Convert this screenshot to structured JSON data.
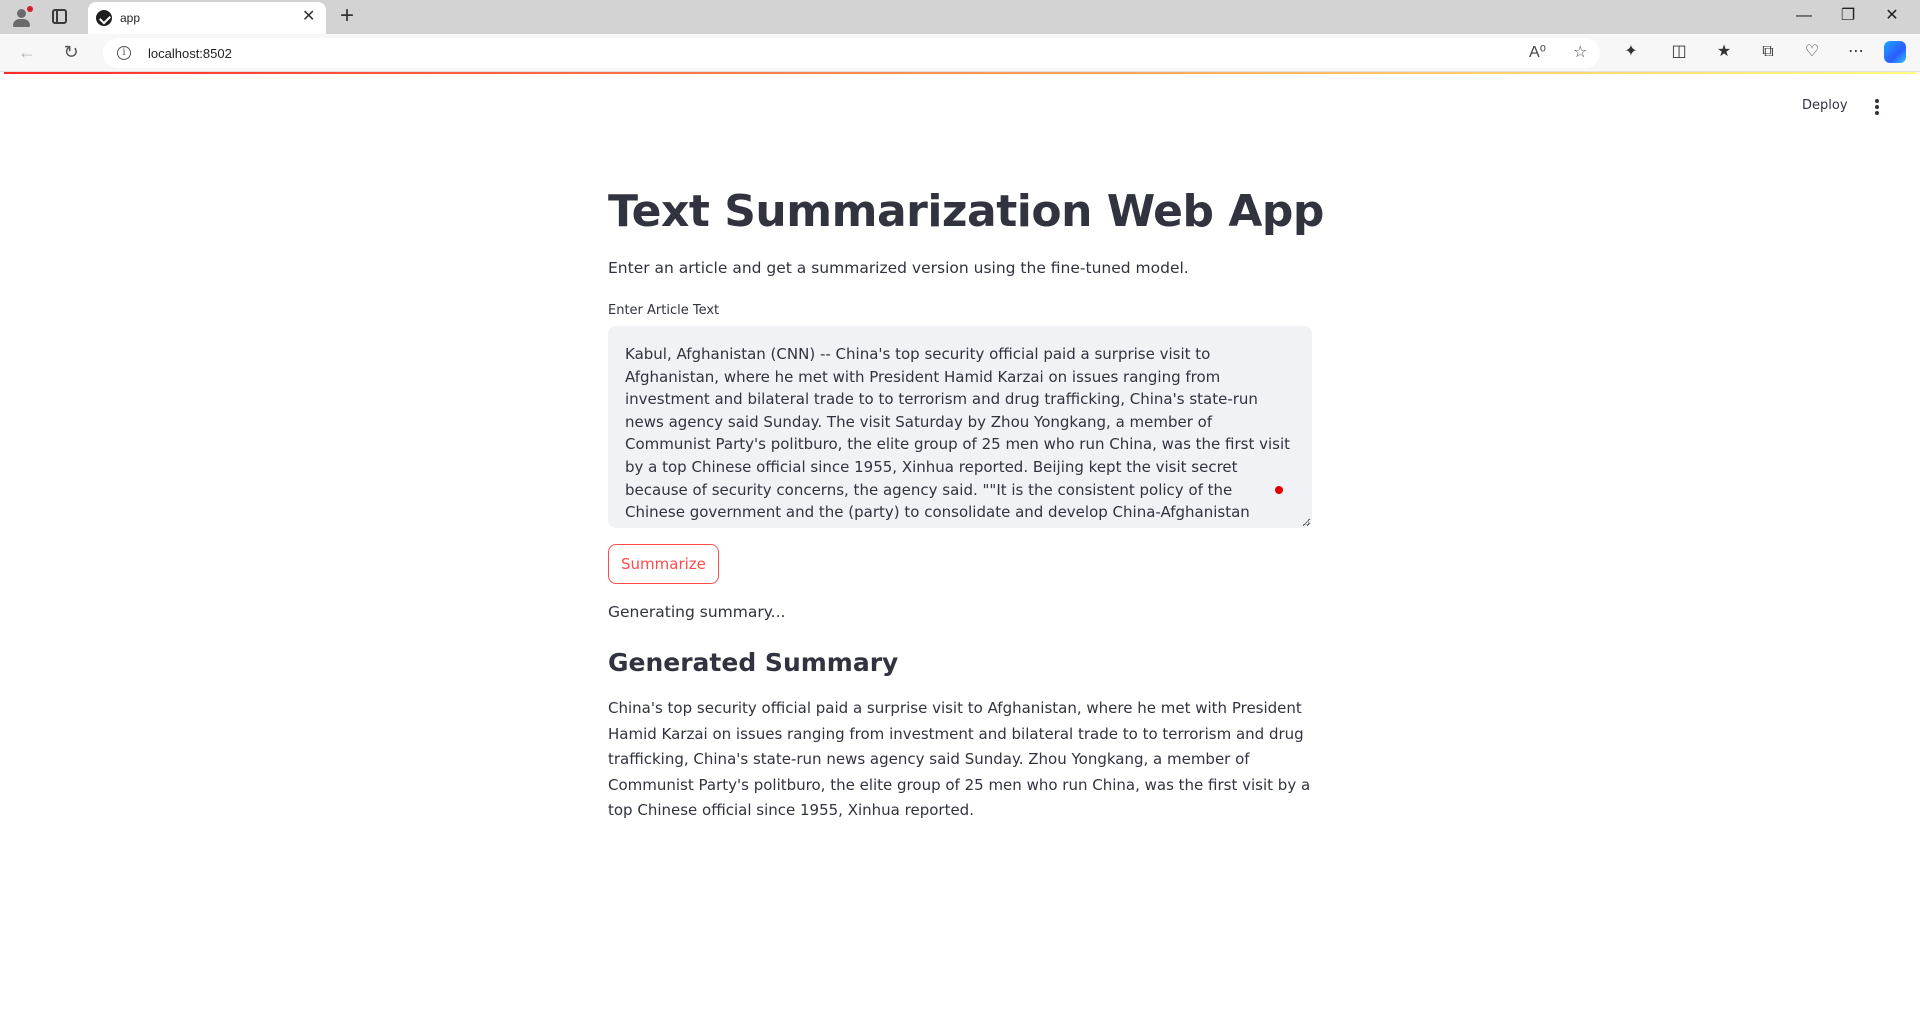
{
  "browser": {
    "tab_title": "app",
    "url": "localhost:8502",
    "new_tab_symbol": "+",
    "tab_close_symbol": "✕"
  },
  "app": {
    "deploy_label": "Deploy",
    "title": "Text Summarization Web App",
    "subtitle": "Enter an article and get a summarized version using the fine-tuned model.",
    "input_label": "Enter Article Text",
    "article_text": "Kabul, Afghanistan (CNN) -- China's top security official paid a surprise visit to Afghanistan, where he met with President Hamid Karzai on issues ranging from investment and bilateral trade to to terrorism and drug trafficking, China's state-run news agency said Sunday. The visit Saturday by Zhou Yongkang, a member of Communist Party's politburo, the elite group of 25 men who run China, was the first visit by a top Chinese official since 1955, Xinhua reported. Beijing kept the visit secret because of security concerns, the agency said. \"\"It is the consistent policy of the Chinese government and the (party) to consolidate and develop China-Afghanistan relations,\"\" Zhou said in a statement reported by Xinhua. Zhou also said China is willing to make \"\"due contributions\"\" to",
    "button_label": "Summarize",
    "status_text": "Generating summary...",
    "summary_heading": "Generated Summary",
    "summary_text": "China's top security official paid a surprise visit to Afghanistan, where he met with President Hamid Karzai on issues ranging from investment and bilateral trade to to terrorism and drug trafficking, China's state-run news agency said Sunday. Zhou Yongkang, a member of Communist Party's politburo, the elite group of 25 men who run China, was the first visit by a top Chinese official since 1955, Xinhua reported."
  },
  "icons": [
    "profile-icon",
    "tab-actions-icon",
    "app-favicon",
    "back-icon",
    "refresh-icon",
    "site-info-icon",
    "read-aloud-icon",
    "favorite-star-icon",
    "extensions-icon",
    "split-screen-icon",
    "favorites-icon",
    "collections-icon",
    "browser-essentials-icon",
    "more-icon",
    "copilot-icon",
    "kebab-menu-icon"
  ],
  "colors": {
    "primary": "#ff4b4b",
    "text": "#31333f",
    "input_bg": "#f0f2f6"
  }
}
